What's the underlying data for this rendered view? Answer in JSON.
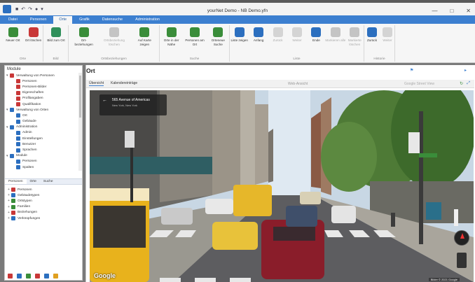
{
  "window": {
    "title": "yourNet Demo - NB Demo.yfn",
    "controls": [
      "—",
      "□",
      "✕"
    ]
  },
  "ribbon_tabs": [
    {
      "label": "Datei",
      "active": false
    },
    {
      "label": "Personen",
      "active": false
    },
    {
      "label": "Orte",
      "active": true
    },
    {
      "label": "Grafik",
      "active": false
    },
    {
      "label": "Datensuche",
      "active": false
    },
    {
      "label": "Administration",
      "active": false
    }
  ],
  "ribbon_groups": [
    {
      "label": "Orte",
      "buttons": [
        {
          "label": "Neuer Ort",
          "icon": "new-place-icon",
          "color": "#3a8d3a",
          "enabled": true
        },
        {
          "label": "Ort löschen",
          "icon": "delete-place-icon",
          "color": "#c93838",
          "enabled": true
        }
      ]
    },
    {
      "label": "Bild",
      "buttons": [
        {
          "label": "Bild zum Ort",
          "icon": "image-icon",
          "color": "#2f8f5a",
          "enabled": true
        }
      ]
    },
    {
      "label": "Ortsbeziehungen",
      "buttons": [
        {
          "label": "Ort-beziehungen",
          "icon": "relations-icon",
          "color": "#3a8d3a",
          "enabled": true
        },
        {
          "label": "Ortsbeziehung löschen",
          "icon": "remove-relation-icon",
          "color": "#888",
          "enabled": false
        },
        {
          "label": "Auf Karte zeigen",
          "icon": "map-pin-icon",
          "color": "#3a8d3a",
          "enabled": true
        }
      ]
    },
    {
      "label": "Suche",
      "buttons": [
        {
          "label": "Orte in der Nähe",
          "icon": "nearby-icon",
          "color": "#3a8d3a",
          "enabled": true
        },
        {
          "label": "Personen am Ort",
          "icon": "people-icon",
          "color": "#3a8d3a",
          "enabled": true
        },
        {
          "label": "Orteneue Suche",
          "icon": "search-icon",
          "color": "#3a8d3a",
          "enabled": true
        }
      ]
    },
    {
      "label": "Liste",
      "buttons": [
        {
          "label": "Liste zeigen",
          "icon": "list-icon",
          "color": "#2c6fbf",
          "enabled": true
        },
        {
          "label": "Anfang",
          "icon": "first-icon",
          "color": "#2c6fbf",
          "enabled": true
        },
        {
          "label": "Zurück",
          "icon": "back-icon",
          "color": "#aaa",
          "enabled": false
        },
        {
          "label": "Weiter",
          "icon": "next-icon",
          "color": "#aaa",
          "enabled": false
        },
        {
          "label": "Ende",
          "icon": "last-icon",
          "color": "#2c6fbf",
          "enabled": true
        },
        {
          "label": "Markieren alle",
          "icon": "mark-all-icon",
          "color": "#888",
          "enabled": false
        },
        {
          "label": "Markierte löschen",
          "icon": "mark-delete-icon",
          "color": "#888",
          "enabled": false
        }
      ]
    },
    {
      "label": "Historie",
      "buttons": [
        {
          "label": "Zurück",
          "icon": "history-back-icon",
          "color": "#2c6fbf",
          "enabled": true
        },
        {
          "label": "Weiter",
          "icon": "history-forward-icon",
          "color": "#aaa",
          "enabled": false
        }
      ]
    }
  ],
  "left_panel": {
    "title": "Module",
    "tree": [
      {
        "label": "Verwaltung von Personen",
        "level": 0,
        "color": "#c93838",
        "expanded": true
      },
      {
        "label": "Personen",
        "level": 1,
        "color": "#c93838"
      },
      {
        "label": "Personen-Bilder",
        "level": 1,
        "color": "#c93838"
      },
      {
        "label": "Eigenschaften",
        "level": 1,
        "color": "#c93838"
      },
      {
        "label": "Profilangaben",
        "level": 1,
        "color": "#c93838"
      },
      {
        "label": "Qualifikation",
        "level": 1,
        "color": "#c93838"
      },
      {
        "label": "Verwaltung von Orten",
        "level": 0,
        "color": "#2c6fbf",
        "expanded": true
      },
      {
        "label": "Ort",
        "level": 1,
        "color": "#2c6fbf"
      },
      {
        "label": "Gebäude",
        "level": 1,
        "color": "#2c6fbf"
      },
      {
        "label": "Administration",
        "level": 0,
        "color": "#2c6fbf",
        "expanded": true
      },
      {
        "label": "Admin",
        "level": 1,
        "color": "#2c6fbf"
      },
      {
        "label": "Einstellungen",
        "level": 1,
        "color": "#2c6fbf"
      },
      {
        "label": "Benutzer",
        "level": 1,
        "color": "#2c6fbf"
      },
      {
        "label": "Sprachen",
        "level": 1,
        "color": "#2c6fbf"
      },
      {
        "label": "Module",
        "level": 0,
        "color": "#2c6fbf",
        "expanded": true
      },
      {
        "label": "Personen",
        "level": 1,
        "color": "#2c6fbf"
      },
      {
        "label": "Spalten",
        "level": 1,
        "color": "#2c6fbf"
      }
    ],
    "bottom_tabs": [
      {
        "label": "Personen",
        "active": true
      },
      {
        "label": "Orte",
        "active": false
      },
      {
        "label": "Suche",
        "active": false
      }
    ],
    "list": [
      {
        "label": "Personen",
        "color": "#c93838"
      },
      {
        "label": "Gebäudetypen",
        "color": "#2c6fbf"
      },
      {
        "label": "Ortstypen",
        "color": "#3a8d3a"
      },
      {
        "label": "Familien",
        "color": "#3a8d3a"
      },
      {
        "label": "Beziehungen",
        "color": "#c93838"
      },
      {
        "label": "Verknüpfungen",
        "color": "#2c6fbf"
      }
    ],
    "bottom_icons": [
      {
        "icon": "person-icon",
        "color": "#c93838"
      },
      {
        "icon": "place-icon",
        "color": "#2c6fbf"
      },
      {
        "icon": "image-icon",
        "color": "#3a8d3a"
      },
      {
        "icon": "search-icon",
        "color": "#c93838"
      },
      {
        "icon": "settings-icon",
        "color": "#2c6fbf"
      },
      {
        "icon": "star-icon",
        "color": "#e0a020"
      }
    ]
  },
  "main": {
    "title": "Ort",
    "subtabs": [
      {
        "label": "Übersicht",
        "active": true
      },
      {
        "label": "Kalendereinträge",
        "active": false
      }
    ],
    "toolbar_center": "Web-Ansicht",
    "toolbar_right": "Google Street View"
  },
  "streetview": {
    "place_title": "565 Avenue of Americas",
    "place_subtitle": "New York, New York",
    "logo": "Google",
    "footer": "Bilder © 2021 Google"
  }
}
